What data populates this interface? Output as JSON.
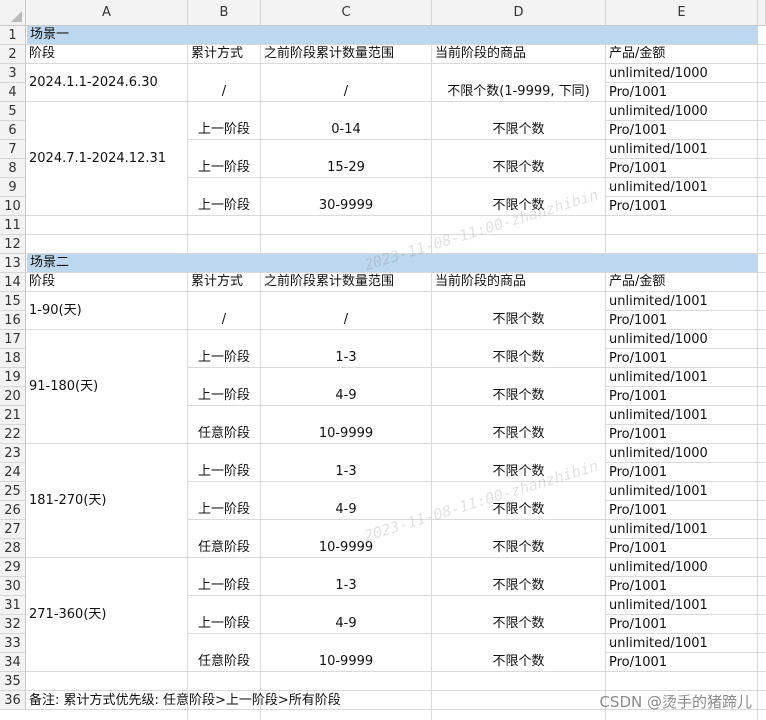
{
  "columns": [
    "A",
    "B",
    "C",
    "D",
    "E"
  ],
  "rows": [
    "1",
    "2",
    "3",
    "4",
    "5",
    "6",
    "7",
    "8",
    "9",
    "10",
    "11",
    "12",
    "13",
    "14",
    "15",
    "16",
    "17",
    "18",
    "19",
    "20",
    "21",
    "22",
    "23",
    "24",
    "25",
    "26",
    "27",
    "28",
    "29",
    "30",
    "31",
    "32",
    "33",
    "34",
    "35",
    "36"
  ],
  "scenario1": {
    "title": "场景一",
    "headers": {
      "stage": "阶段",
      "method": "累计方式",
      "range": "之前阶段累计数量范围",
      "goods": "当前阶段的商品",
      "product": "产品/金额"
    },
    "stages": [
      {
        "label": "2024.1.1-2024.6.30",
        "method": "/",
        "range": "/",
        "goods": "不限个数(1-9999, 下同)"
      },
      {
        "label": "2024.7.1-2024.12.31",
        "rows": [
          {
            "method": "上一阶段",
            "range": "0-14",
            "goods": "不限个数"
          },
          {
            "method": "上一阶段",
            "range": "15-29",
            "goods": "不限个数"
          },
          {
            "method": "上一阶段",
            "range": "30-9999",
            "goods": "不限个数"
          }
        ]
      }
    ],
    "products": [
      [
        "unlimited/1000",
        "Pro/1001"
      ],
      [
        "unlimited/1000",
        "Pro/1001"
      ],
      [
        "unlimited/1001",
        "Pro/1001"
      ],
      [
        "unlimited/1001",
        "Pro/1001"
      ]
    ]
  },
  "scenario2": {
    "title": "场景二",
    "headers": {
      "stage": "阶段",
      "method": "累计方式",
      "range": "之前阶段累计数量范围",
      "goods": "当前阶段的商品",
      "product": "产品/金额"
    },
    "stages": [
      {
        "label": "1-90(天)",
        "rows": [
          {
            "method": "/",
            "range": "/",
            "goods": "不限个数"
          }
        ]
      },
      {
        "label": "91-180(天)",
        "rows": [
          {
            "method": "上一阶段",
            "range": "1-3",
            "goods": "不限个数"
          },
          {
            "method": "上一阶段",
            "range": "4-9",
            "goods": "不限个数"
          },
          {
            "method": "任意阶段",
            "range": "10-9999",
            "goods": "不限个数"
          }
        ]
      },
      {
        "label": "181-270(天)",
        "rows": [
          {
            "method": "上一阶段",
            "range": "1-3",
            "goods": "不限个数"
          },
          {
            "method": "上一阶段",
            "range": "4-9",
            "goods": "不限个数"
          },
          {
            "method": "任意阶段",
            "range": "10-9999",
            "goods": "不限个数"
          }
        ]
      },
      {
        "label": "271-360(天)",
        "rows": [
          {
            "method": "上一阶段",
            "range": "1-3",
            "goods": "不限个数"
          },
          {
            "method": "上一阶段",
            "range": "4-9",
            "goods": "不限个数"
          },
          {
            "method": "任意阶段",
            "range": "10-9999",
            "goods": "不限个数"
          }
        ]
      }
    ],
    "products": [
      [
        "unlimited/1001",
        "Pro/1001"
      ],
      [
        "unlimited/1000",
        "Pro/1001"
      ],
      [
        "unlimited/1001",
        "Pro/1001"
      ],
      [
        "unlimited/1001",
        "Pro/1001"
      ],
      [
        "unlimited/1000",
        "Pro/1001"
      ],
      [
        "unlimited/1001",
        "Pro/1001"
      ],
      [
        "unlimited/1001",
        "Pro/1001"
      ],
      [
        "unlimited/1000",
        "Pro/1001"
      ],
      [
        "unlimited/1001",
        "Pro/1001"
      ],
      [
        "unlimited/1001",
        "Pro/1001"
      ]
    ]
  },
  "note": "备注: 累计方式优先级: 任意阶段>上一阶段>所有阶段",
  "watermarks": [
    "2023-11-08-11:00-zhanzhibin",
    "2023-11-08-11:00-zhanzhibin"
  ],
  "csdn_mark": "CSDN @烫手的猪蹄儿",
  "colors": {
    "band": "#bdd7ee",
    "grid": "#d9d9d9",
    "header_bg": "#f3f3f3"
  }
}
